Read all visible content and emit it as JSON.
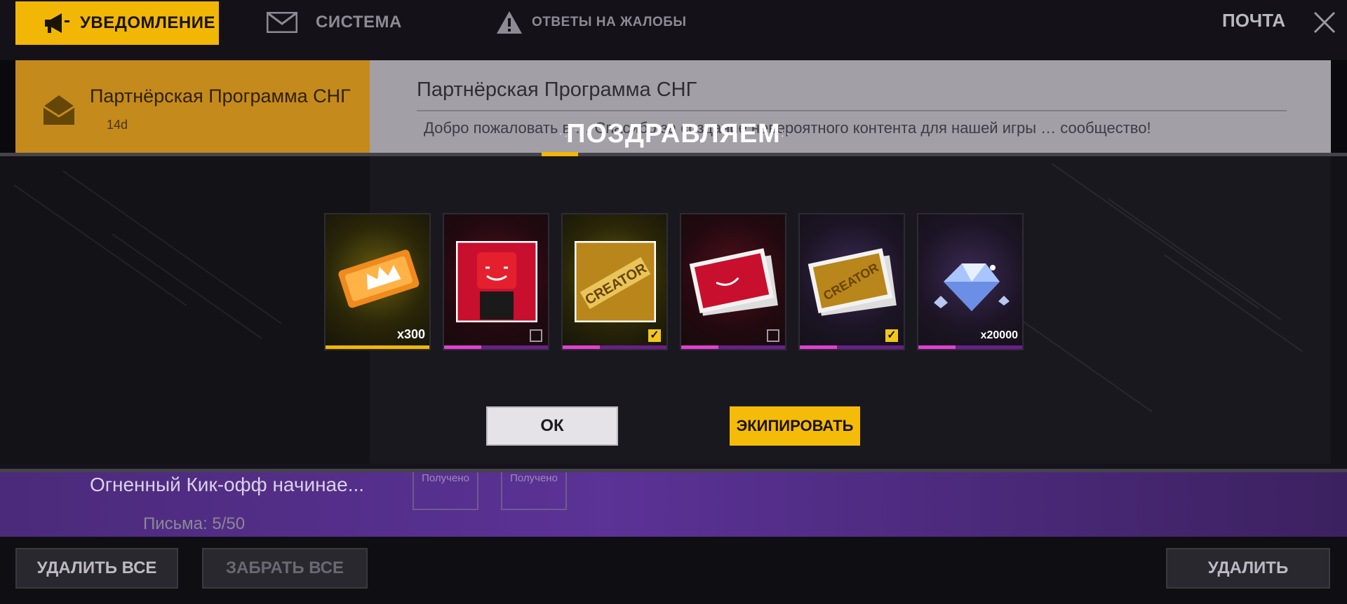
{
  "tabs": {
    "notification": "УВЕДОМЛЕНИЕ",
    "system": "СИСТЕМА",
    "reports": "ОТВЕТЫ НА ЖАЛОБЫ"
  },
  "header": {
    "mail_title": "ПОЧТА"
  },
  "mail_list": {
    "items": [
      {
        "title": "Партнёрская Программа СНГ",
        "age": "14d"
      },
      {
        "title": "Огненный Кик-офф начинае..."
      }
    ],
    "letters_count": "Письма: 5/50"
  },
  "detail": {
    "title": "Партнёрская Программа СНГ",
    "body": "Добро пожаловать в … Спасибо за создание невероятного контента для нашей игры … сообщество!",
    "claimed_label": "Получено"
  },
  "modal": {
    "title": "ПОЗДРАВЛЯЕМ",
    "rewards": [
      {
        "name": "ticket",
        "qty": "x300"
      },
      {
        "name": "avatar-red",
        "checked": false
      },
      {
        "name": "creator-avatar",
        "checked": true
      },
      {
        "name": "banner-red",
        "checked": false
      },
      {
        "name": "creator-banner",
        "checked": true
      },
      {
        "name": "diamond",
        "qty": "x20000"
      }
    ],
    "ok_label": "ОК",
    "equip_label": "ЭКИПИРОВАТЬ"
  },
  "bottom": {
    "delete_all": "УДАЛИТЬ ВСЕ",
    "claim_all": "ЗАБРАТЬ ВСЕ",
    "delete": "УДАЛИТЬ"
  },
  "colors": {
    "accent": "#f2b705",
    "rarity_purple": "#e33fd6"
  }
}
